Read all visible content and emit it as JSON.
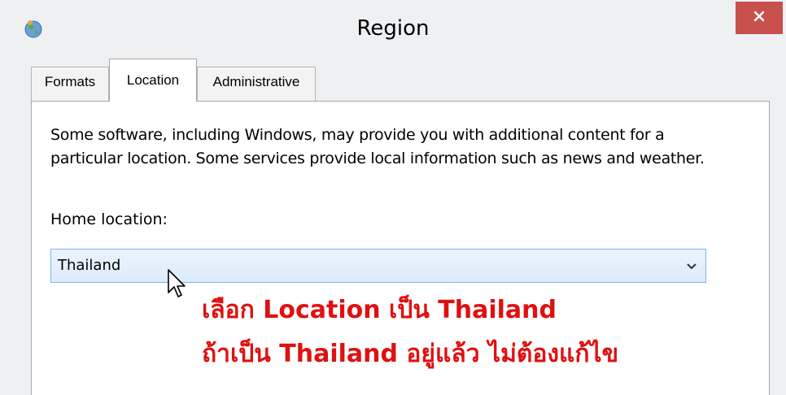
{
  "window": {
    "title": "Region",
    "close_icon": "close-icon",
    "app_icon": "globe-icon"
  },
  "tabs": [
    {
      "label": "Formats",
      "selected": false
    },
    {
      "label": "Location",
      "selected": true
    },
    {
      "label": "Administrative",
      "selected": false
    }
  ],
  "location": {
    "description": "Some software, including Windows, may provide you with additional content for a particular location. Some services provide local information such as news and weather.",
    "home_label": "Home location:",
    "home_value": "Thailand"
  },
  "annotation": {
    "line1": "เลือก Location เป็น Thailand",
    "line2": "ถ้าเป็น Thailand อยู่แล้ว ไม่ต้องแก้ไข"
  },
  "colors": {
    "close_button": "#c7504d",
    "annotation": "#e01010",
    "dropdown_border": "#7eb4ea"
  }
}
